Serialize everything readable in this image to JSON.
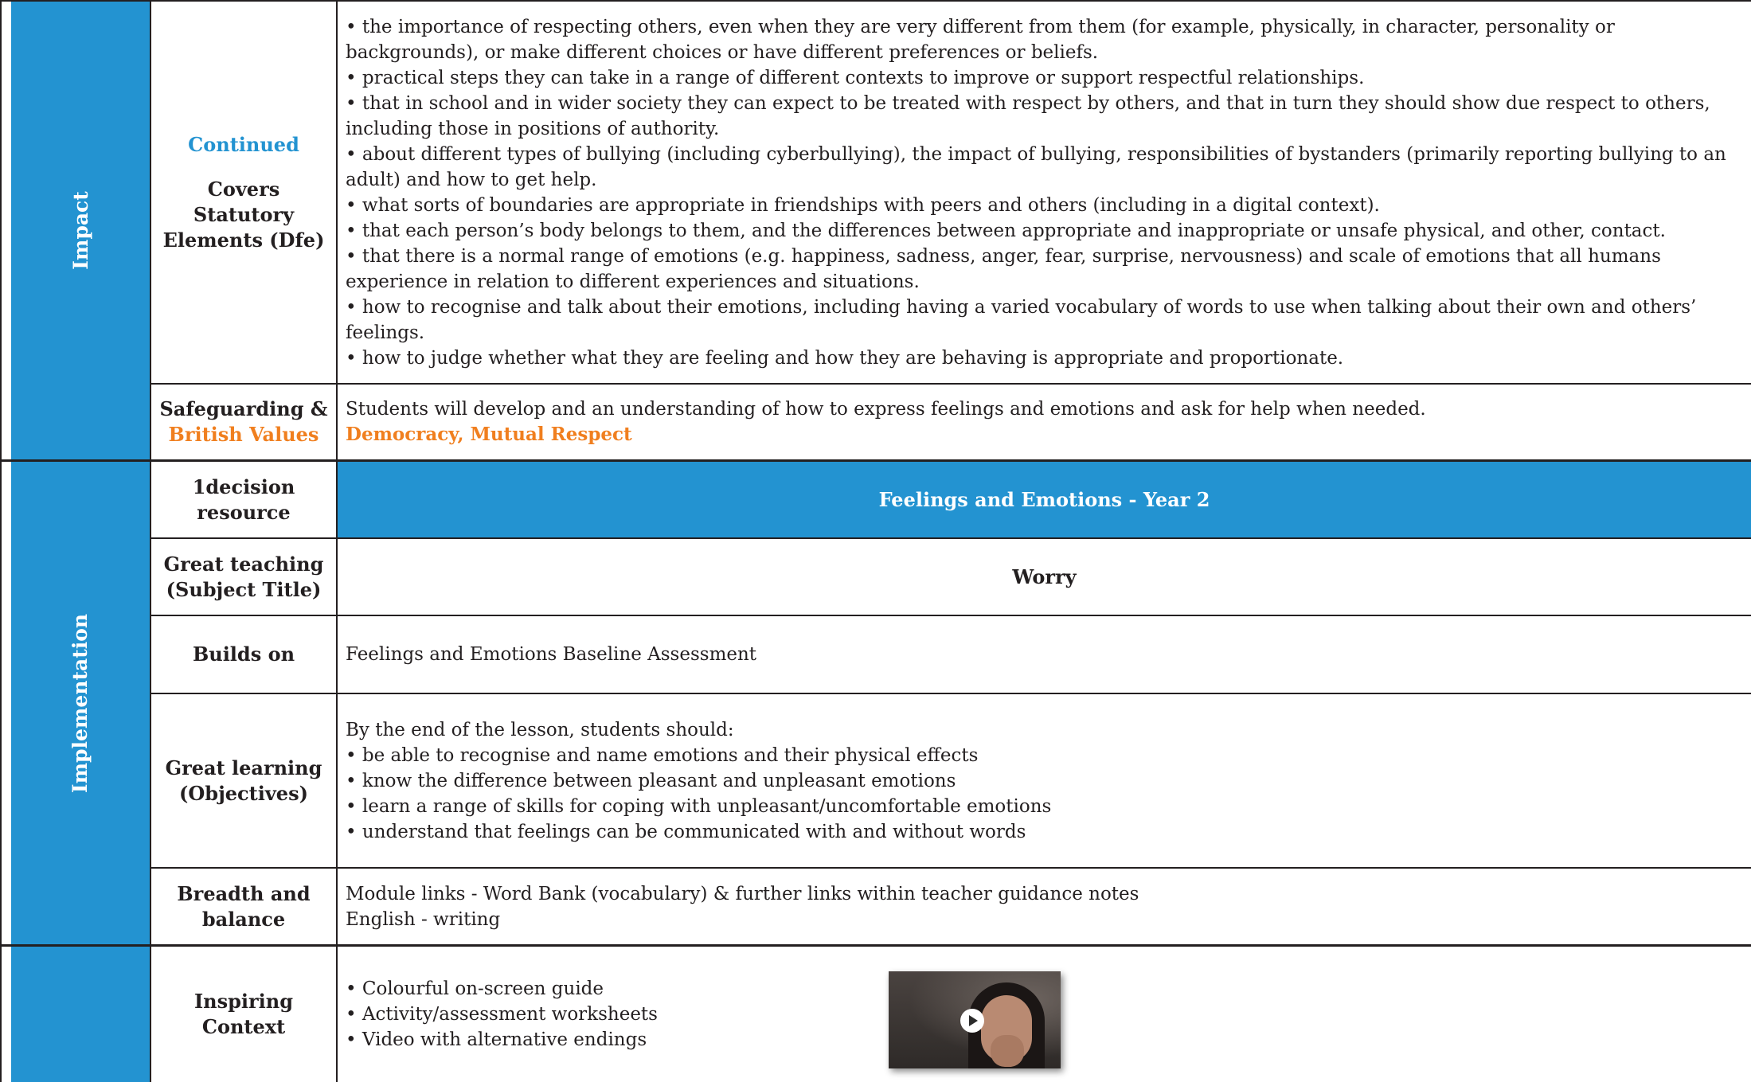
{
  "sections": {
    "impact": "Impact",
    "implementation": "Implementation",
    "third": ""
  },
  "rows": {
    "statutory": {
      "label_continued": "Continued",
      "label_main": "Covers Statutory Elements (Dfe)",
      "bullets": [
        "• the importance of respecting others, even when they are very different from them (for example, physically, in character, personality or backgrounds), or make different choices or have different preferences or beliefs.",
        "• practical steps they can take in a range of different contexts to improve or support respectful relationships.",
        "• that in school and in wider society they can expect to be treated with respect by others, and that in turn they should show due respect to others, including those in positions of authority.",
        "• about different types of bullying (including cyberbullying), the impact of bullying, responsibilities of bystanders (primarily reporting bullying to an adult) and how to get help.",
        "• what sorts of boundaries are appropriate in friendships with peers and others (including in a digital context).",
        "• that each person’s body belongs to them, and the differences between appropriate and inappropriate or unsafe physical, and other, contact.",
        "• that there is a normal range of emotions (e.g. happiness, sadness, anger, fear, surprise, nervousness) and scale of emotions that all humans experience in relation to different experiences and situations.",
        "• how to recognise and talk about their emotions, including having a varied vocabulary of words to use when talking about their own and others’ feelings.",
        "• how to judge whether what they are feeling and how they are behaving is appropriate and proportionate."
      ]
    },
    "safeguarding": {
      "label_line1": "Safeguarding &",
      "label_line2": "British Values",
      "text": "Students will develop and an understanding of how to express feelings and emotions and ask for help when needed.",
      "values": "Democracy, Mutual Respect"
    },
    "resource": {
      "label": "1decision resource",
      "banner": "Feelings and Emotions - Year 2"
    },
    "teaching": {
      "label": "Great teaching (Subject Title)",
      "title": "Worry"
    },
    "builds": {
      "label": "Builds on",
      "text": "Feelings and Emotions Baseline Assessment"
    },
    "learning": {
      "label": "Great learning (Objectives)",
      "intro": "By the end of the lesson, students should:",
      "bullets": [
        "• be able to recognise and name emotions and their physical effects",
        "• know the difference between pleasant and unpleasant emotions",
        "• learn a range of skills for coping with unpleasant/uncomfortable emotions",
        "• understand that feelings can be communicated with and without words"
      ]
    },
    "breadth": {
      "label": "Breadth and balance",
      "lines": [
        "Module links - Word Bank (vocabulary) & further links within teacher guidance notes",
        "English - writing"
      ]
    },
    "inspiring": {
      "label": "Inspiring Context",
      "bullets": [
        "• Colourful on-screen guide",
        "• Activity/assessment worksheets",
        "• Video with alternative endings"
      ]
    }
  },
  "colors": {
    "accent_blue": "#2393d1",
    "accent_orange": "#f07f1f",
    "text": "#231f20"
  },
  "icons": {
    "video_play": "play-icon"
  }
}
